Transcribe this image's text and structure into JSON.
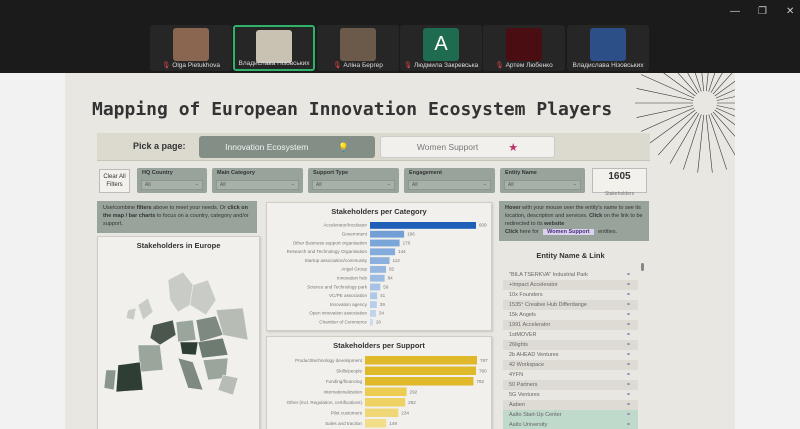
{
  "window_controls": {
    "minimize": "—",
    "maximize": "❐",
    "close": "✕"
  },
  "participants": [
    {
      "name": "Olga Pietukhova",
      "muted": true,
      "color": "#8a6650"
    },
    {
      "name": "Владислава Нізовських",
      "muted": false,
      "color": "#c9c2b2",
      "active": true
    },
    {
      "name": "Аліна Бергер",
      "muted": true,
      "color": "#6b5a4a"
    },
    {
      "name": "Людмила Закревська",
      "muted": true,
      "color": "#1f6b4f",
      "initial": "A"
    },
    {
      "name": "Артем Любенко",
      "muted": true,
      "color": "#4a0d12"
    },
    {
      "name": "Владислава Нізовських",
      "muted": false,
      "color": "#2b4f86"
    }
  ],
  "dashboard": {
    "title": "Mapping of European Innovation Ecosystem Players",
    "pick_label": "Pick a page:",
    "pages": [
      {
        "label": "Innovation Ecosystem",
        "icon": "💡"
      },
      {
        "label": "Women Support",
        "icon": "★"
      }
    ],
    "clear_filters": "Clear All Filters",
    "filters": [
      {
        "label": "HQ Country",
        "value": "All"
      },
      {
        "label": "Main Category",
        "value": "All"
      },
      {
        "label": "Support Type",
        "value": "All"
      },
      {
        "label": "Engagement",
        "value": "All"
      },
      {
        "label": "Entity Name",
        "value": "All"
      }
    ],
    "stakeholder_count": "1605",
    "stakeholder_count_label": "Stakeholders",
    "left_note": {
      "t1": "Use/combine ",
      "b1": "filters",
      "t2": " above to meet your needs. Or ",
      "b2": "click on the map / bar charts",
      "t3": " to focus on a country, category and/or support."
    },
    "map_title": "Stakeholders in Europe",
    "right_note": {
      "b1": "Hover",
      "t1": " with your mouse over the entity's name to see its location, description and services. ",
      "b2": "Click",
      "t2": " on the link to be redirected to its ",
      "b3": "website",
      "b4": "Click",
      "t3": " here for ",
      "badge": "Women Support",
      "t4": " entities."
    },
    "list_title": "Entity Name & Link",
    "entities": [
      "\"BILA TSERKVA\" Industrial Park",
      "+Impact Accelerator",
      "10x Founders",
      "1535° Creative Hub Differdange",
      "15k Angels",
      "1991 Accelerator",
      "1stMOVER",
      "26lights",
      "2b AHEAD Ventures",
      "42 Workspace",
      "4YFN",
      "50 Partners",
      "5G Ventures",
      "Aaben",
      "Aalto Start-Up Center",
      "Aalto University"
    ]
  },
  "chart_data": [
    {
      "type": "bar",
      "title": "Stakeholders per Category",
      "orientation": "horizontal",
      "color": "#4a86d0",
      "highlight_color": "#1f5fb8",
      "categories": [
        "Accelerator/Incubator",
        "Government",
        "Other Business support organisation",
        "Research and Technology Organisation",
        "Startup association/community",
        "Angel Group",
        "Innovation hub",
        "Science and Technology park",
        "VC/PE association",
        "Innovation agency",
        "Open innovation association",
        "Chamber of Commerce"
      ],
      "values": [
        609,
        196,
        170,
        144,
        112,
        92,
        84,
        59,
        41,
        39,
        34,
        16
      ]
    },
    {
      "type": "bar",
      "title": "Stakeholders per Support",
      "orientation": "horizontal",
      "color": "#e3bc2a",
      "categories": [
        "Product/technology development",
        "Skills/people",
        "Funding/financing",
        "Internationalization",
        "Other (incl. Regulation, certifications)",
        "Pilot customers",
        "Sales and traction"
      ],
      "values": [
        787,
        780,
        762,
        292,
        282,
        234,
        149
      ]
    }
  ]
}
